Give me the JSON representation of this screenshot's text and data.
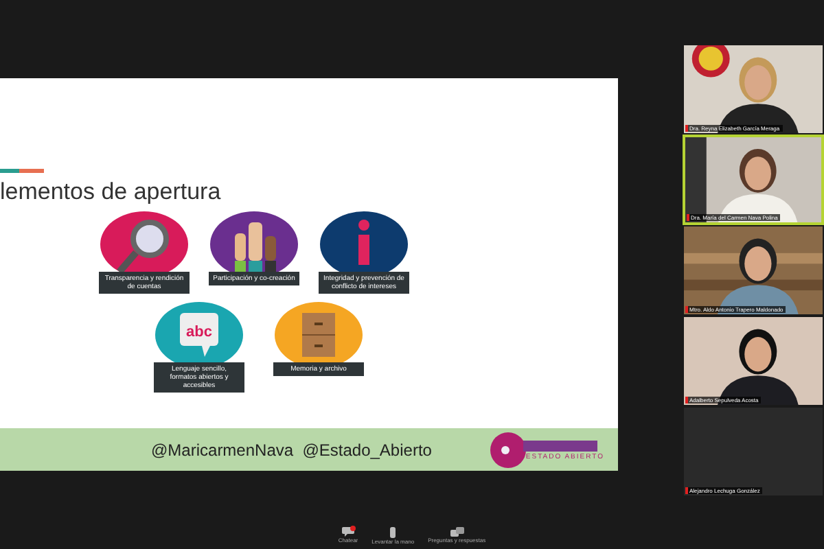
{
  "slide": {
    "title": "lementos de apertura",
    "items": [
      {
        "kind": "magnifier",
        "color": "#d81b5a",
        "label": "Transparencia y rendición de cuentas"
      },
      {
        "kind": "hands",
        "color": "#6a2f8f",
        "label": "Participación y co-creación"
      },
      {
        "kind": "info",
        "color": "#0d3b6e",
        "label": "Integridad y prevención de conflicto de intereses"
      },
      {
        "kind": "speech",
        "color": "#1aa6b0",
        "label": "Lenguaje sencillo, formatos abiertos y accesibles",
        "icon_text": "abc"
      },
      {
        "kind": "cabinet",
        "color": "#f5a623",
        "label": "Memoria y archivo"
      }
    ],
    "footer": {
      "handles": "@MaricarmenNava  @Estado_Abierto",
      "logo_text": "ESTADO ABIERTO"
    }
  },
  "participants": [
    {
      "name": "Dra. Reyna Elizabeth García Meraga",
      "speaking": false,
      "muted": true,
      "kind": "office"
    },
    {
      "name": "Dra. María del Carmen Nava Polina",
      "speaking": true,
      "muted": true,
      "kind": "wall"
    },
    {
      "name": "Mtro. Aldo Antonio Trapero Maldonado",
      "speaking": false,
      "muted": true,
      "kind": "wood"
    },
    {
      "name": "Adalberto Sepulveda Acosta",
      "speaking": false,
      "muted": true,
      "kind": "plain"
    },
    {
      "name": "Alejandro Lechuga González",
      "speaking": false,
      "muted": true,
      "kind": "none"
    }
  ],
  "toolbar": [
    {
      "label": "Chatear",
      "kind": "chat",
      "badge": true
    },
    {
      "label": "Levantar la mano",
      "kind": "hand",
      "badge": false
    },
    {
      "label": "Preguntas y respuestas",
      "kind": "qa",
      "badge": false
    }
  ]
}
